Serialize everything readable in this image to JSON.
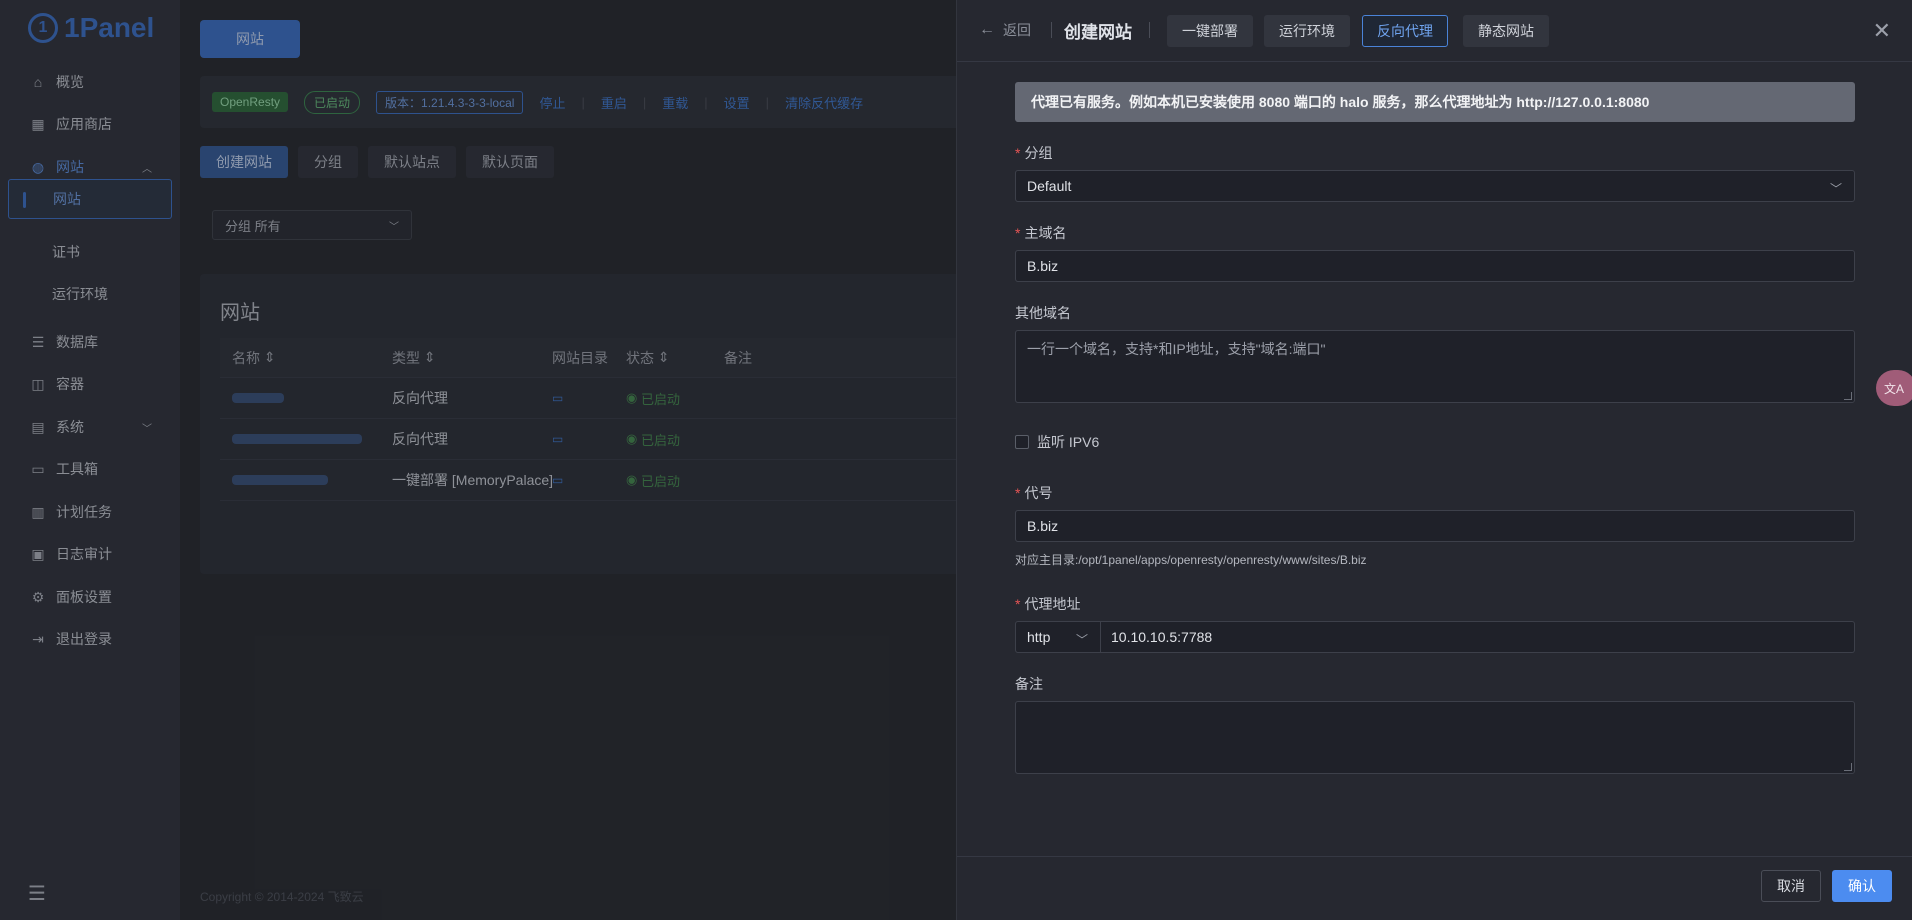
{
  "sidebar": {
    "logo": "1Panel",
    "items": [
      {
        "label": "概览",
        "icon": "home-icon"
      },
      {
        "label": "应用商店",
        "icon": "grid-icon"
      },
      {
        "label": "网站",
        "icon": "globe-icon"
      },
      {
        "label": "网站",
        "icon": ""
      },
      {
        "label": "证书",
        "icon": ""
      },
      {
        "label": "运行环境",
        "icon": ""
      },
      {
        "label": "数据库",
        "icon": "database-icon"
      },
      {
        "label": "容器",
        "icon": "container-icon"
      },
      {
        "label": "系统",
        "icon": "server-icon"
      },
      {
        "label": "工具箱",
        "icon": "toolbox-icon"
      },
      {
        "label": "计划任务",
        "icon": "schedule-icon"
      },
      {
        "label": "日志审计",
        "icon": "log-icon"
      },
      {
        "label": "面板设置",
        "icon": "gear-icon"
      },
      {
        "label": "退出登录",
        "icon": "logout-icon"
      }
    ]
  },
  "main": {
    "page_tab": "网站",
    "status": {
      "app": "OpenResty",
      "state": "已启动",
      "version": "版本：1.21.4.3-3-3-local",
      "actions": [
        "停止",
        "重启",
        "重载",
        "设置",
        "清除反代缓存"
      ]
    },
    "subtabs": [
      "创建网站",
      "分组",
      "默认站点",
      "默认页面"
    ],
    "group_filter": "分组 所有",
    "card_title": "网站",
    "table": {
      "headers": [
        "名称",
        "类型",
        "网站目录",
        "状态",
        "备注"
      ],
      "rows": [
        {
          "type": "反向代理",
          "status": "已启动"
        },
        {
          "type": "反向代理",
          "status": "已启动"
        },
        {
          "type": "一键部署 [MemoryPalace]",
          "status": "已启动"
        }
      ]
    },
    "copyright": "Copyright © 2014-2024 飞致云"
  },
  "drawer": {
    "back": "返回",
    "title": "创建网站",
    "tabs": [
      "一键部署",
      "运行环境",
      "反向代理",
      "静态网站"
    ],
    "active_tab": "反向代理",
    "alert": "代理已有服务。例如本机已安装使用 8080 端口的 halo 服务，那么代理地址为 http://127.0.0.1:8080",
    "form": {
      "group_label": "分组",
      "group_value": "Default",
      "domain_label": "主域名",
      "domain_value": "B.biz",
      "other_domains_label": "其他域名",
      "other_domains_placeholder": "一行一个域名，支持*和IP地址，支持\"域名:端口\"",
      "ipv6_label": "监听 IPV6",
      "alias_label": "代号",
      "alias_value": "B.biz",
      "alias_hint": "对应主目录:/opt/1panel/apps/openresty/openresty/www/sites/B.biz",
      "proxy_label": "代理地址",
      "proxy_protocol": "http",
      "proxy_value": "10.10.10.5:7788",
      "remark_label": "备注"
    },
    "cancel": "取消",
    "confirm": "确认"
  },
  "colors": {
    "accent": "#4c8cf0",
    "required": "#e65454",
    "running": "#45894f"
  }
}
